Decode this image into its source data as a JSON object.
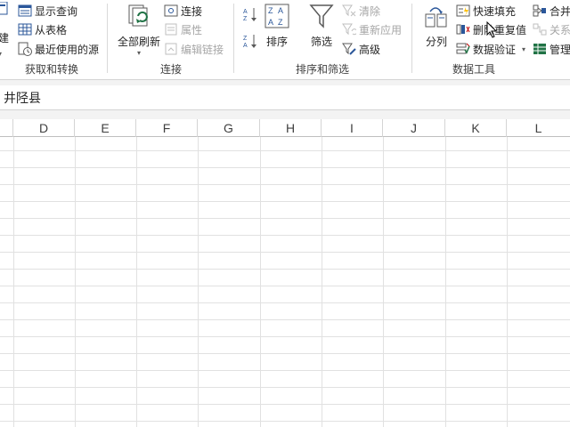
{
  "ribbon": {
    "get_transform": {
      "label": "获取和转换",
      "new_partial": "建",
      "show_queries": "显示查询",
      "from_table": "从表格",
      "recent_sources": "最近使用的源"
    },
    "connections": {
      "label": "连接",
      "refresh_all": "全部刷新",
      "connections": "连接",
      "properties": "属性",
      "edit_links": "编辑链接"
    },
    "sort_filter": {
      "label": "排序和筛选",
      "sort": "排序",
      "filter": "筛选",
      "clear": "清除",
      "reapply": "重新应用",
      "advanced": "高级"
    },
    "data_tools": {
      "label": "数据工具",
      "text_to_columns": "分列",
      "flash_fill": "快速填充",
      "remove_duplicates": "删除重复值",
      "data_validation": "数据验证",
      "consolidate": "合并",
      "relationships": "关系",
      "manage": "管理"
    }
  },
  "formula_bar": {
    "value": "井陉县"
  },
  "columns": [
    "D",
    "E",
    "F",
    "G",
    "H",
    "I",
    "J",
    "K",
    "L"
  ],
  "colors": {
    "accent_blue": "#2b579a",
    "green": "#217346",
    "grid": "#e1e1e1"
  }
}
